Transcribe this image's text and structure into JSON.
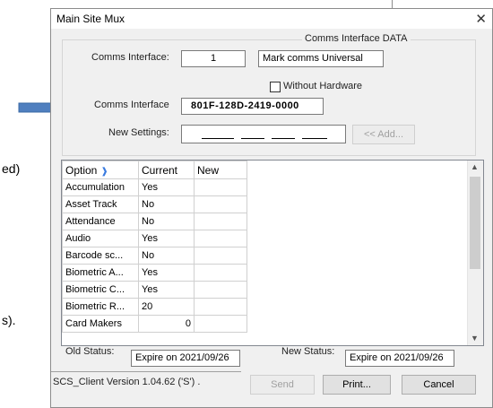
{
  "background": {
    "text1": "ed)",
    "text2": "s)."
  },
  "dialog": {
    "title": "Main Site Mux",
    "close": "✕",
    "group_title": "Comms Interface DATA",
    "comms_interface_label": "Comms Interface:",
    "comms_interface_value": "1",
    "mark_comms": "Mark comms Universal",
    "without_hardware": "Without Hardware",
    "comms_interface_id_label": "Comms Interface",
    "comms_interface_id": "801F-128D-2419-0000",
    "new_settings_label": "New Settings:",
    "add_button": "<< Add...",
    "table": {
      "headers": [
        "Option",
        "Current",
        "New"
      ],
      "rows": [
        [
          "Accumulation",
          "Yes",
          ""
        ],
        [
          "Asset Track",
          "No",
          ""
        ],
        [
          "Attendance",
          "No",
          ""
        ],
        [
          "Audio",
          "Yes",
          ""
        ],
        [
          "Barcode sc...",
          "No",
          ""
        ],
        [
          "Biometric A...",
          "Yes",
          ""
        ],
        [
          "Biometric C...",
          "Yes",
          ""
        ],
        [
          "Biometric R...",
          "20",
          ""
        ],
        [
          "Card Makers",
          "0",
          ""
        ]
      ]
    },
    "old_status_label": "Old Status:",
    "old_status": "Expire on 2021/09/26",
    "new_status_label": "New Status:",
    "new_status": "Expire on 2021/09/26",
    "version": "SCS_Client Version 1.04.62 ('S') .",
    "send_button": "Send",
    "print_button": "Print...",
    "cancel_button": "Cancel"
  },
  "colors": {
    "arrow_fill": "#4f7fbf",
    "arrow_stroke": "#3a6aa6",
    "sort_icon": "#3a7be0"
  }
}
